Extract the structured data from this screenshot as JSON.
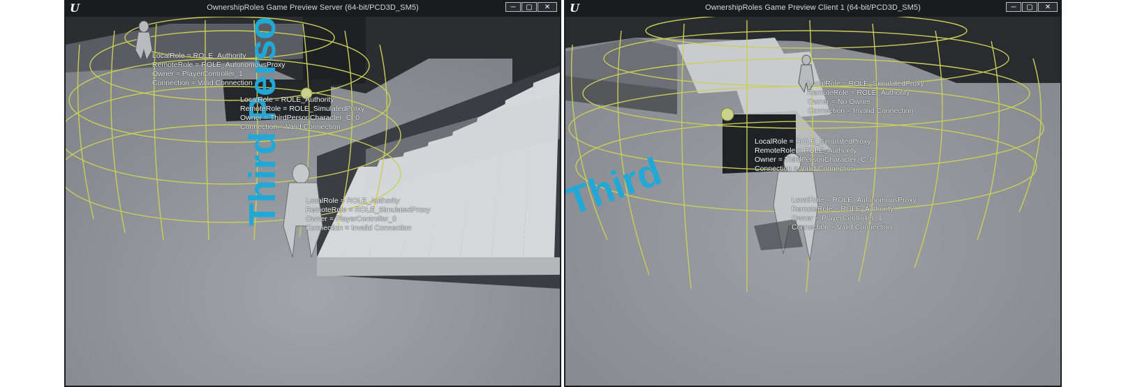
{
  "server_window": {
    "title": "OwnershipRoles Game Preview Server (64-bit/PCD3D_SM5)",
    "logo": "ue-logo",
    "controls": [
      "minimize-icon",
      "maximize-icon",
      "close-icon"
    ],
    "floor_text": "Third Person",
    "debug_labels": [
      {
        "lines": [
          "LocalRole = ROLE_Authority",
          "RemoteRole = ROLE_AutonomousProxy",
          "Owner = PlayerController_1",
          "Connection = Valid Connection"
        ]
      },
      {
        "lines": [
          "LocalRole = ROLE_Authority",
          "RemoteRole = ROLE_SimulatedProxy",
          "Owner = ThirdPersonCharacter_C_0",
          "Connection = Valid Connection"
        ]
      },
      {
        "lines": [
          "LocalRole = ROLE_Authority",
          "RemoteRole = ROLE_SimulatedProxy",
          "Owner = PlayerController_0",
          "Connection = Invalid Connection"
        ]
      }
    ]
  },
  "client_window": {
    "title": "OwnershipRoles Game Preview Client 1 (64-bit/PCD3D_SM5)",
    "logo": "ue-logo",
    "controls": [
      "minimize-icon",
      "maximize-icon",
      "close-icon"
    ],
    "floor_text": "Third",
    "debug_labels": [
      {
        "lines": [
          "LocalRole = ROLE_SimulatedProxy",
          "RemoteRole = ROLE_Authority",
          "Owner = No Owner",
          "Connection = Invalid Connection"
        ]
      },
      {
        "lines": [
          "LocalRole = ROLE_SimulatedProxy",
          "RemoteRole = ROLE_Authority",
          "Owner = ThirdPersonCharacter_C_0",
          "Connection = Valid Connection"
        ]
      },
      {
        "lines": [
          "LocalRole = ROLE_AutonomousProxy",
          "RemoteRole = ROLE_Authority",
          "Owner = PlayerController_1",
          "Connection = Valid Connection"
        ]
      }
    ]
  },
  "colors": {
    "debug_sphere": "#c9cf5a",
    "floor_text": "#22a8d6",
    "window_frame": "#1a1b1f"
  }
}
